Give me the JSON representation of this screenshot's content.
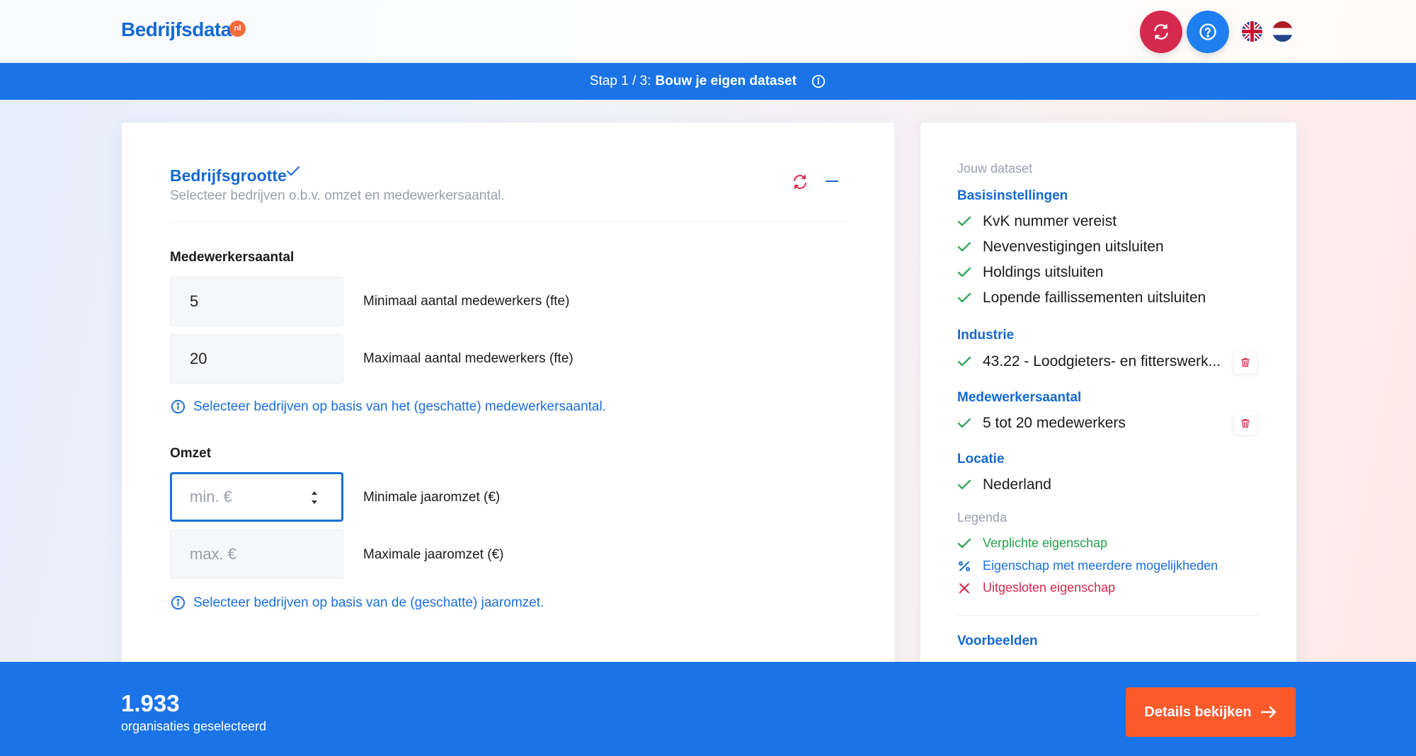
{
  "header": {
    "logo_text": "Bedrijfsdata",
    "logo_badge": "nl",
    "reset_icon": "refresh-icon",
    "help_icon": "help-circle-icon",
    "languages": [
      "en",
      "nl"
    ]
  },
  "step": {
    "prefix": "Stap 1 / 3:",
    "title": "Bouw je eigen dataset",
    "icon": "info-icon"
  },
  "section": {
    "title": "Bedrijfsgrootte",
    "subtitle": "Selecteer bedrijven o.b.v. omzet en medewerkersaantal.",
    "employees": {
      "label": "Medewerkersaantal",
      "min_value": "5",
      "min_label": "Minimaal aantal medewerkers (fte)",
      "max_value": "20",
      "max_label": "Maximaal aantal medewerkers (fte)",
      "hint": "Selecteer bedrijven op basis van het (geschatte) medewerkersaantal."
    },
    "revenue": {
      "label": "Omzet",
      "min_placeholder": "min. €",
      "min_label": "Minimale jaaromzet (€)",
      "max_placeholder": "max. €",
      "max_label": "Maximale jaaromzet (€)",
      "hint": "Selecteer bedrijven op basis van de (geschatte) jaaromzet."
    }
  },
  "summary": {
    "title": "Jouw dataset",
    "basis": {
      "heading": "Basisinstellingen",
      "items": [
        "KvK nummer vereist",
        "Nevenvestigingen uitsluiten",
        "Holdings uitsluiten",
        "Lopende faillissementen uitsluiten"
      ]
    },
    "industry": {
      "heading": "Industrie",
      "item": "43.22 - Loodgieters- en fitterswerk..."
    },
    "employees": {
      "heading": "Medewerkersaantal",
      "item": "5 tot 20 medewerkers"
    },
    "location": {
      "heading": "Locatie",
      "item": "Nederland"
    },
    "legend": {
      "heading": "Legenda",
      "required": "Verplichte eigenschap",
      "multiple": "Eigenschap met meerdere mogelijkheden",
      "excluded": "Uitgesloten eigenschap"
    },
    "examples_heading": "Voorbeelden"
  },
  "footer": {
    "count": "1.933",
    "count_label": "organisaties geselecteerd",
    "button_label": "Details bekijken"
  },
  "colors": {
    "primary": "#1a74e8",
    "heading_blue": "#1469d3",
    "accent_orange": "#fb5a2b",
    "danger": "#d6294f",
    "success": "#22a24a"
  }
}
